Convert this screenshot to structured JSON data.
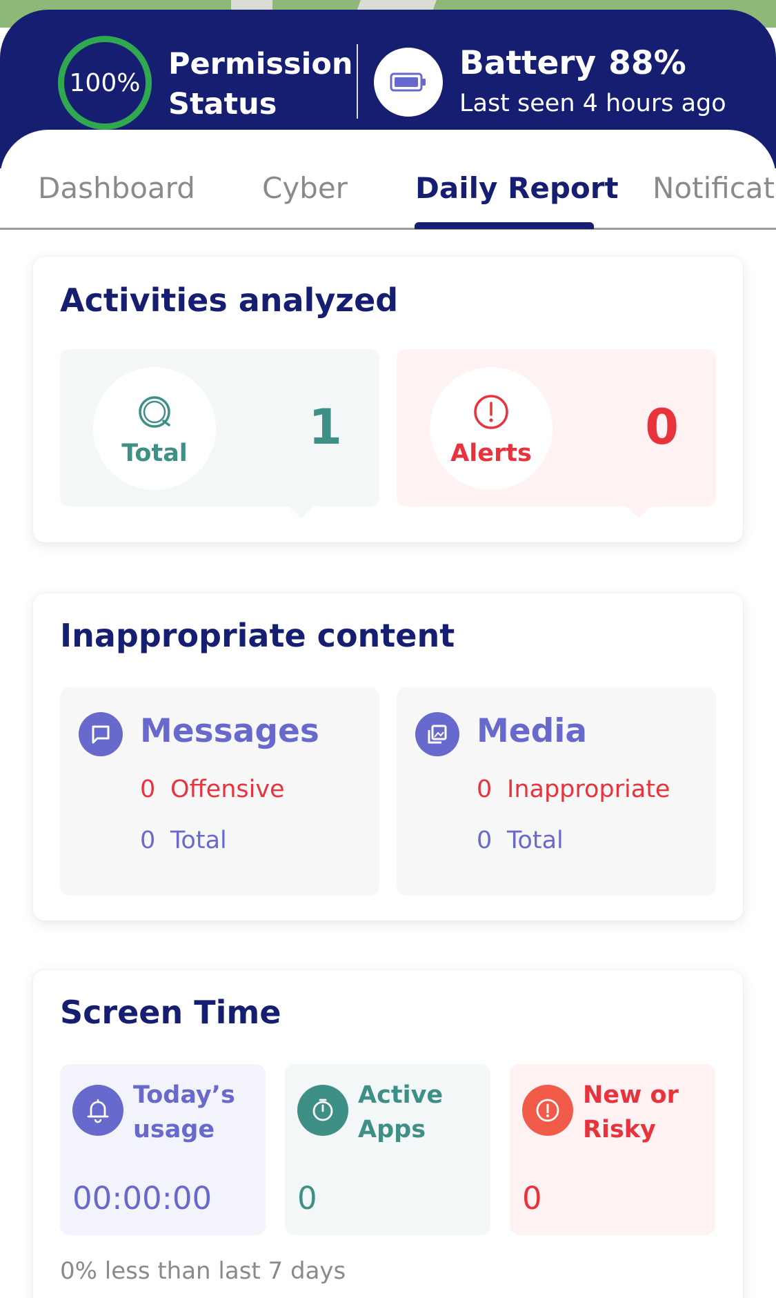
{
  "header": {
    "permission_percent": "100%",
    "permission_label_line1": "Permission",
    "permission_label_line2": "Status",
    "battery_label": "Battery",
    "battery_percent": "88%",
    "last_seen": "Last seen 4 hours ago",
    "icons": [
      "battery-icon"
    ]
  },
  "tabs": [
    {
      "label": "Dashboard",
      "active": false
    },
    {
      "label": "Cyber",
      "active": false
    },
    {
      "label": "Daily Report",
      "active": true
    },
    {
      "label": "Notificati",
      "active": false
    }
  ],
  "activities": {
    "title": "Activities analyzed",
    "total_label": "Total",
    "total_value": "1",
    "alerts_label": "Alerts",
    "alerts_value": "0"
  },
  "inappropriate": {
    "title": "Inappropriate content",
    "messages": {
      "title": "Messages",
      "offensive_count": "0",
      "offensive_label": "Offensive",
      "total_count": "0",
      "total_label": "Total"
    },
    "media": {
      "title": "Media",
      "inappropriate_count": "0",
      "inappropriate_label": "Inappropriate",
      "total_count": "0",
      "total_label": "Total"
    }
  },
  "screen_time": {
    "title": "Screen Time",
    "today_label": "Today’s usage",
    "today_value": "00:00:00",
    "active_label": "Active Apps",
    "active_value": "0",
    "risky_label": "New or Risky",
    "risky_value": "0",
    "footer": "0% less than last 7 days"
  },
  "colors": {
    "navy": "#161e71",
    "green_ring": "#2fa84f",
    "teal": "#3e8f86",
    "red": "#e8333d",
    "purple": "#6769cc",
    "coral": "#f25a4a"
  }
}
